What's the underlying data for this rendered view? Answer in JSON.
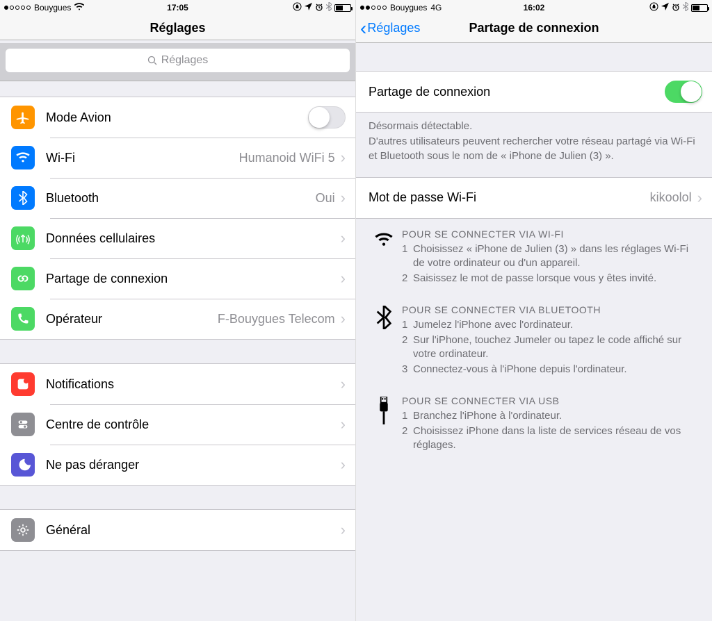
{
  "left": {
    "status": {
      "carrier": "Bouygues",
      "signal_filled": 1,
      "network_label": "",
      "time": "17:05"
    },
    "nav_title": "Réglages",
    "search_placeholder": "Réglages",
    "group1": [
      {
        "name": "mode-avion",
        "label": "Mode Avion",
        "value": "",
        "type": "switch",
        "on": false,
        "icon": "airplane"
      },
      {
        "name": "wifi",
        "label": "Wi-Fi",
        "value": "Humanoid WiFi 5",
        "type": "link",
        "icon": "wifi"
      },
      {
        "name": "bluetooth",
        "label": "Bluetooth",
        "value": "Oui",
        "type": "link",
        "icon": "bluetooth"
      },
      {
        "name": "cellular",
        "label": "Données cellulaires",
        "value": "",
        "type": "link",
        "icon": "cellular"
      },
      {
        "name": "hotspot",
        "label": "Partage de connexion",
        "value": "",
        "type": "link",
        "icon": "hotspot"
      },
      {
        "name": "carrier",
        "label": "Opérateur",
        "value": "F-Bouygues Telecom",
        "type": "link",
        "icon": "phone"
      }
    ],
    "group2": [
      {
        "name": "notifications",
        "label": "Notifications",
        "icon": "notifications"
      },
      {
        "name": "controlcenter",
        "label": "Centre de contrôle",
        "icon": "controlcenter"
      },
      {
        "name": "dnd",
        "label": "Ne pas déranger",
        "icon": "dnd"
      }
    ],
    "group3": [
      {
        "name": "general",
        "label": "Général",
        "icon": "general"
      }
    ]
  },
  "right": {
    "status": {
      "carrier": "Bouygues",
      "signal_filled": 2,
      "network_label": "4G",
      "time": "16:02"
    },
    "back_label": "Réglages",
    "nav_title": "Partage de connexion",
    "toggle": {
      "label": "Partage de connexion",
      "on": true
    },
    "blurb_title": "Désormais détectable.",
    "blurb_body": "D'autres utilisateurs peuvent rechercher votre réseau partagé via Wi-Fi et Bluetooth sous le nom de « iPhone de Julien (3) ».",
    "password": {
      "label": "Mot de passe Wi-Fi",
      "value": "kikoolol"
    },
    "sections": [
      {
        "icon": "wifi",
        "title": "POUR SE CONNECTER VIA WI-FI",
        "steps": [
          "Choisissez « iPhone de Julien (3) » dans les réglages Wi-Fi de votre ordinateur ou d'un appareil.",
          "Saisissez le mot de passe lorsque vous y êtes invité."
        ]
      },
      {
        "icon": "bluetooth",
        "title": "POUR SE CONNECTER VIA BLUETOOTH",
        "steps": [
          "Jumelez l'iPhone avec l'ordinateur.",
          "Sur l'iPhone, touchez Jumeler ou tapez le code affiché sur votre ordinateur.",
          "Connectez-vous à l'iPhone depuis l'ordinateur."
        ]
      },
      {
        "icon": "usb",
        "title": "POUR SE CONNECTER VIA USB",
        "steps": [
          "Branchez l'iPhone à l'ordinateur.",
          "Choisissez iPhone dans la liste de services réseau de vos réglages."
        ]
      }
    ]
  }
}
